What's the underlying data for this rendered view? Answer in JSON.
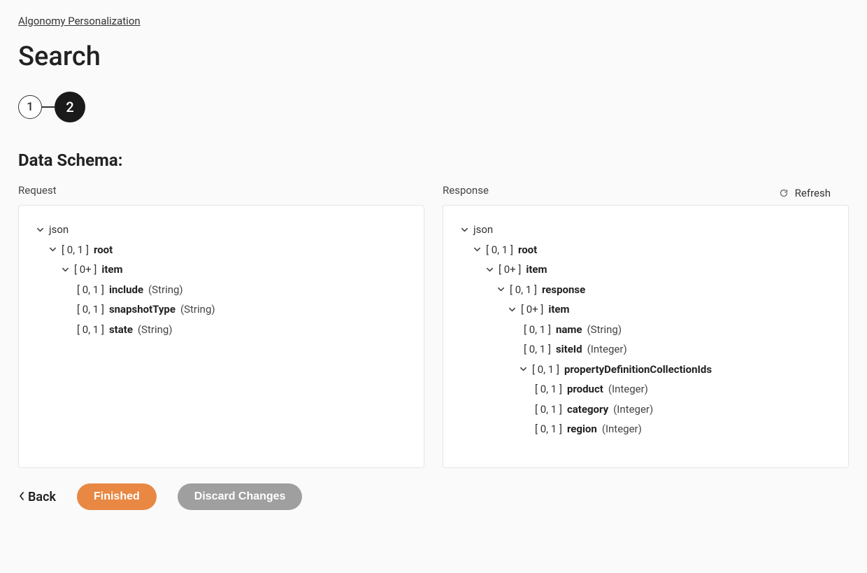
{
  "breadcrumb": "Algonomy Personalization",
  "title": "Search",
  "steps": [
    "1",
    "2"
  ],
  "active_step_index": 1,
  "section_title": "Data Schema:",
  "refresh_label": "Refresh",
  "columns": {
    "request": {
      "label": "Request",
      "tree": [
        {
          "indent": 0,
          "caret": true,
          "range": "",
          "name": "json",
          "type": "",
          "bold": false
        },
        {
          "indent": 1,
          "caret": true,
          "range": "[ 0, 1 ]",
          "name": "root",
          "type": "",
          "bold": true
        },
        {
          "indent": 2,
          "caret": true,
          "range": "[ 0+ ]",
          "name": "item",
          "type": "",
          "bold": true
        },
        {
          "indent": 3,
          "caret": false,
          "range": "[ 0, 1 ]",
          "name": "include",
          "type": "(String)",
          "bold": true
        },
        {
          "indent": 3,
          "caret": false,
          "range": "[ 0, 1 ]",
          "name": "snapshotType",
          "type": "(String)",
          "bold": true
        },
        {
          "indent": 3,
          "caret": false,
          "range": "[ 0, 1 ]",
          "name": "state",
          "type": "(String)",
          "bold": true
        }
      ]
    },
    "response": {
      "label": "Response",
      "tree": [
        {
          "indent": 0,
          "caret": true,
          "range": "",
          "name": "json",
          "type": "",
          "bold": false
        },
        {
          "indent": 1,
          "caret": true,
          "range": "[ 0, 1 ]",
          "name": "root",
          "type": "",
          "bold": true
        },
        {
          "indent": 2,
          "caret": true,
          "range": "[ 0+ ]",
          "name": "item",
          "type": "",
          "bold": true
        },
        {
          "indent": 3,
          "caret": true,
          "range": "[ 0, 1 ]",
          "name": "response",
          "type": "",
          "bold": true
        },
        {
          "indent": 4,
          "caret": true,
          "range": "[ 0+ ]",
          "name": "item",
          "type": "",
          "bold": true
        },
        {
          "indent": 5,
          "caret": false,
          "range": "[ 0, 1 ]",
          "name": "name",
          "type": "(String)",
          "bold": true
        },
        {
          "indent": 5,
          "caret": false,
          "range": "[ 0, 1 ]",
          "name": "siteId",
          "type": "(Integer)",
          "bold": true
        },
        {
          "indent": 5,
          "caret": true,
          "range": "[ 0, 1 ]",
          "name": "propertyDefinitionCollectionIds",
          "type": "",
          "bold": true
        },
        {
          "indent": 6,
          "caret": false,
          "range": "[ 0, 1 ]",
          "name": "product",
          "type": "(Integer)",
          "bold": true
        },
        {
          "indent": 6,
          "caret": false,
          "range": "[ 0, 1 ]",
          "name": "category",
          "type": "(Integer)",
          "bold": true
        },
        {
          "indent": 6,
          "caret": false,
          "range": "[ 0, 1 ]",
          "name": "region",
          "type": "(Integer)",
          "bold": true
        }
      ]
    }
  },
  "actions": {
    "back": "Back",
    "finished": "Finished",
    "discard": "Discard Changes"
  }
}
